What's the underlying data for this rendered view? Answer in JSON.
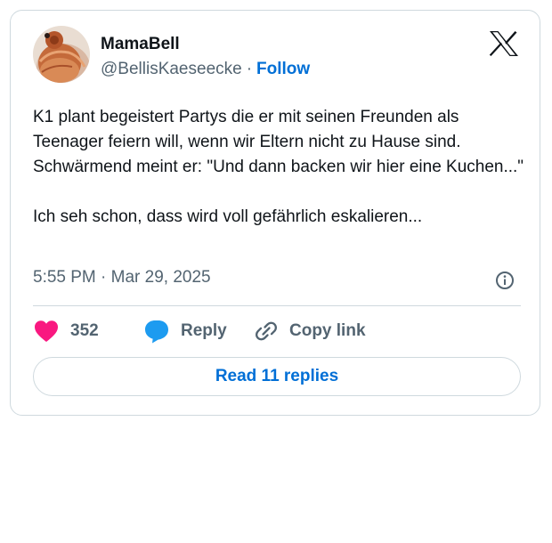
{
  "author": {
    "display_name": "MamaBell",
    "handle": "@BellisKaeseecke",
    "separator": "·",
    "follow_label": "Follow",
    "avatar_icon": "profile-photo-redhead-bun"
  },
  "brand": {
    "logo_icon": "x-logo-icon"
  },
  "tweet": {
    "text": "K1 plant begeistert Partys die er mit seinen Freunden als Teenager feiern will, wenn wir Eltern nicht zu Hause sind. Schwärmend meint er: \"Und dann backen wir hier eine Kuchen...\"\n\nIch seh schon, dass wird voll gefährlich eskalieren...",
    "time": "5:55 PM",
    "meta_separator": "·",
    "date": "Mar 29, 2025"
  },
  "actions": {
    "like_count": "352",
    "reply_label": "Reply",
    "copy_link_label": "Copy link"
  },
  "read_replies_label": "Read 11 replies",
  "colors": {
    "like": "#f91880",
    "reply": "#1d9bf0",
    "link": "#006fd6",
    "muted": "#536471",
    "border": "#cfd9de"
  }
}
